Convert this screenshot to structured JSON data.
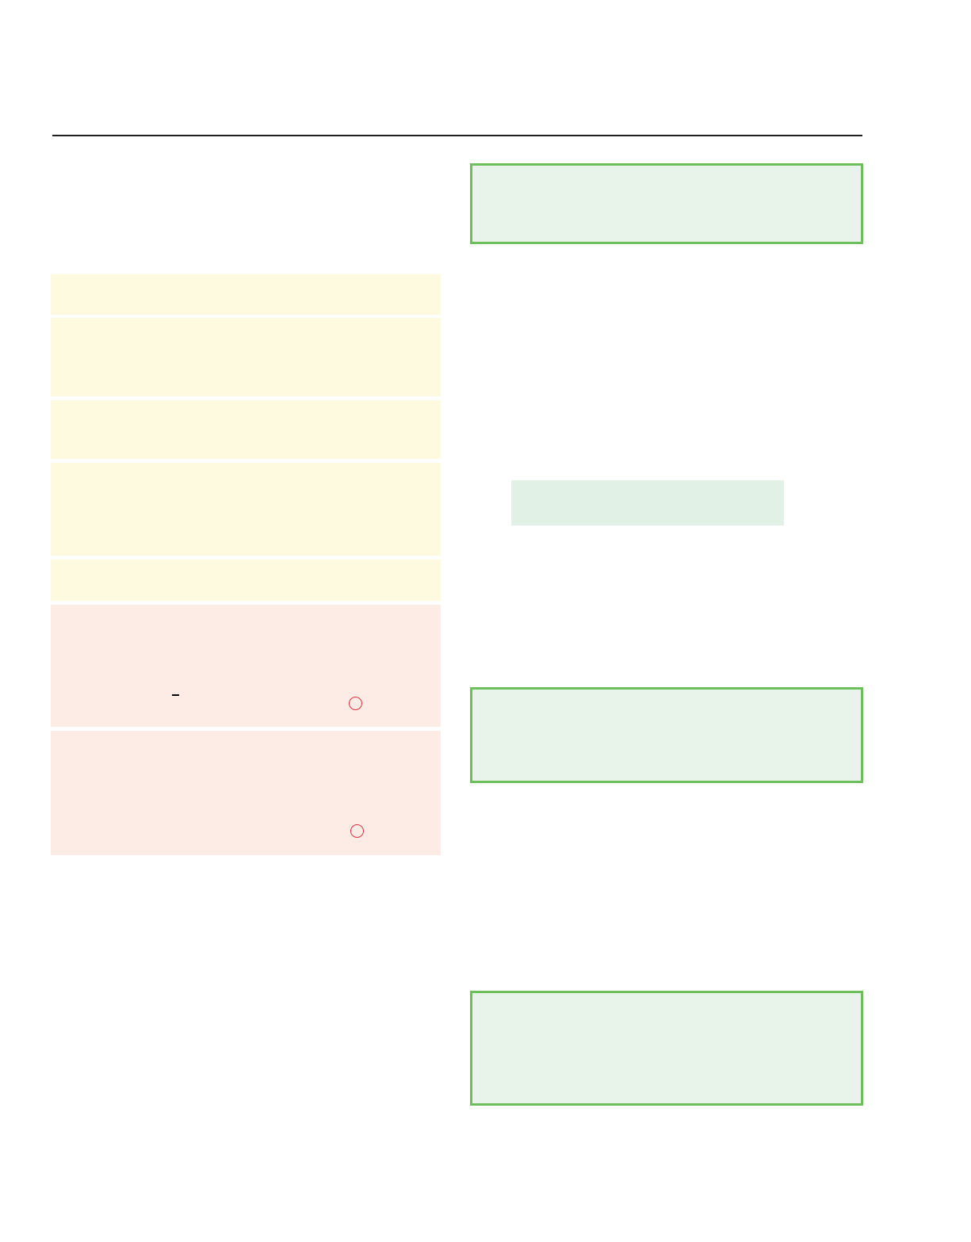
{
  "colors": {
    "rule": "#1f1f1f",
    "green_border": "#6cbf5a",
    "green_fill": "#e8f4ea",
    "green_shade": "#e1f1e6",
    "yellow_fill": "#fefae0",
    "red_fill": "#fdece6",
    "circle_stroke": "#d9333f",
    "dash": "#000000"
  },
  "icons": {
    "circle_marks": [
      "red-circle-icon",
      "red-circle-icon"
    ],
    "dash_mark": "dash-icon"
  }
}
